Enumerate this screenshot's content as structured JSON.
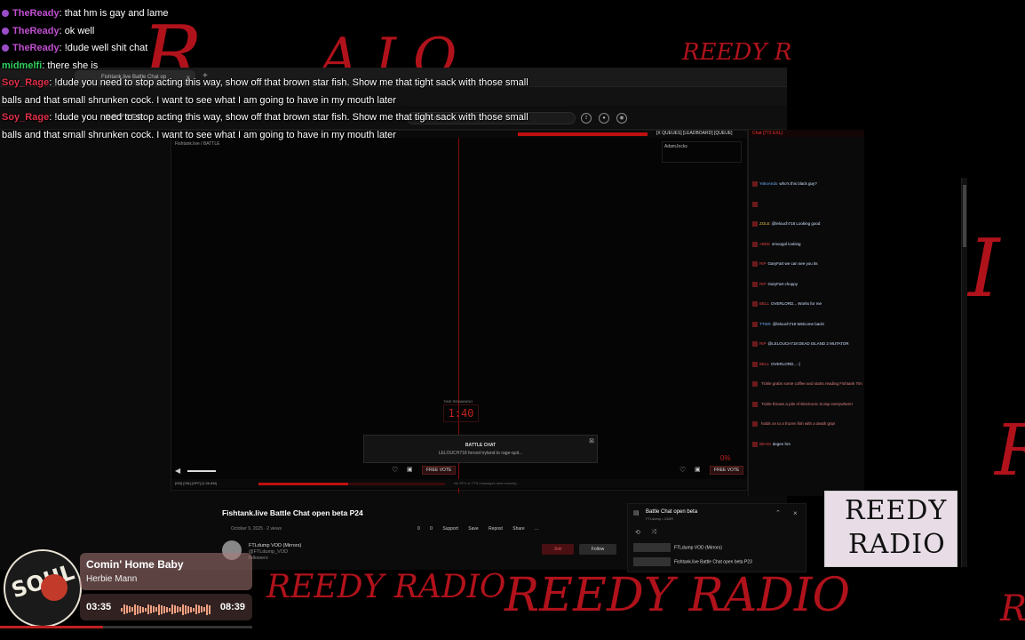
{
  "overlay": {
    "branding_text": "REEDY RADIO",
    "chat": [
      {
        "user": "TheReady",
        "text": ": that hm is gay and lame",
        "color": "purple"
      },
      {
        "user": "TheReady",
        "text": ": ok well",
        "color": "purple"
      },
      {
        "user": "TheReady",
        "text": ": !dude well shit chat",
        "color": "purple"
      },
      {
        "user": "midmelfi",
        "text": ": there she is",
        "color": "green"
      },
      {
        "user": "Soy_Rage",
        "text": ": !dude you need to stop acting this way, show off that brown star fish. Show me that tight sack with those small balls and that small shrunken cock. I want to see what I am going to have in my mouth later",
        "color": "red"
      },
      {
        "user": "Soy_Rage",
        "text": ": !dude you need to stop acting this way, show off that brown star fish. Show me that tight sack with those small balls and that small shrunken cock. I want to see what I am going to have in my mouth later",
        "color": "red"
      }
    ]
  },
  "browser": {
    "tab_title": "Fishtank.live Battle Chat op",
    "tab_close": "×",
    "tab_add": "+",
    "site_logo": "ODYSEE",
    "search_placeholder": "Search"
  },
  "stream": {
    "tabs_label": "[X QUEUES] [LEADBOARD] [QUEUE]",
    "cam_top_left": "Fishtank.live / BATTLE",
    "cam_top_right_name": "AdamJocks",
    "timer_label": "TIME REMAINING",
    "timer": "1:40",
    "battle_chat_title": "BATTLE CHAT",
    "battle_chat_msg": "LELOUCH718 forced tryland to rage-quit...",
    "percent": "0%",
    "free_vote": "FREE VOTE",
    "status_text": "[ON] [ON] [OFF] [1:26 AM]",
    "status_right": "No SFX or TTS messages sent recently...",
    "progress_pct": 0.48
  },
  "right_chat": {
    "header": "Chat [772 EXL]",
    "messages": [
      {
        "name": "YokoAndo",
        "text": "who's this black guy?",
        "style": "blue"
      },
      {
        "name": "",
        "text": "",
        "style": "yel"
      },
      {
        "name": "ZOLE",
        "text": "@lelouch718 Looking good",
        "style": "yel"
      },
      {
        "name": "ABEE",
        "text": "smoogol looking",
        "style": "red"
      },
      {
        "name": "RIP",
        "text": "GaryFart we can see you its",
        "style": "red"
      },
      {
        "name": "RIP",
        "text": "GaryFart choppy",
        "style": "red"
      },
      {
        "name": "BELL",
        "text": "OVERLORD... Works for me",
        "style": "red"
      },
      {
        "name": "TTWS",
        "text": "@lelouch718 Welcome back!",
        "style": "blue"
      },
      {
        "name": "RIP",
        "text": "@LELOUCH718 DEAD ISLAND 2 MUTATOR",
        "style": "red"
      },
      {
        "name": "BELL",
        "text": "OVERLORD... :(",
        "style": "red"
      },
      {
        "name": "",
        "text": "Tickle grabs some coffee and starts reading Fishtank Times",
        "style": "note"
      },
      {
        "name": "",
        "text": "Tickle throws a pile of Electronic Scrap everywhere!",
        "style": "note"
      },
      {
        "name": "",
        "text": "holds on to a frozen fish with a death grip!",
        "style": "note"
      },
      {
        "name": "BEAM",
        "text": "degen hrs",
        "style": "red"
      }
    ]
  },
  "video": {
    "title": "Fishtank.live Battle Chat open beta P24",
    "meta": "October 9, 2025 · 2 views",
    "actions": [
      "0",
      "0",
      "Support",
      "Save",
      "Repost",
      "Share",
      "..."
    ],
    "channel_name": "FTLdump VOD (Mirrors)",
    "channel_handle": "@FTLdump_VOD",
    "channel_followers": "followers",
    "join_label": "Join",
    "follow_label": "Follow"
  },
  "playlist": {
    "title": "Battle Chat open beta",
    "subtitle": "FTLdump • 24/89",
    "items": [
      {
        "label": "FTLdump VOD (Mirrors)"
      },
      {
        "label": "Fishtank.live Battle Chat open beta P23"
      }
    ]
  },
  "now_playing": {
    "title": "Comin' Home Baby",
    "artist": "Herbie Mann",
    "current": "03:35",
    "total": "08:39",
    "progress": 0.41,
    "art_text": "SOUL"
  },
  "logo": {
    "line1": "REEDY",
    "line2": "RADIO"
  },
  "colors": {
    "accent_red": "#c01010",
    "scrawl_red": "#c4141e",
    "purple_user": "#c04fd0"
  }
}
